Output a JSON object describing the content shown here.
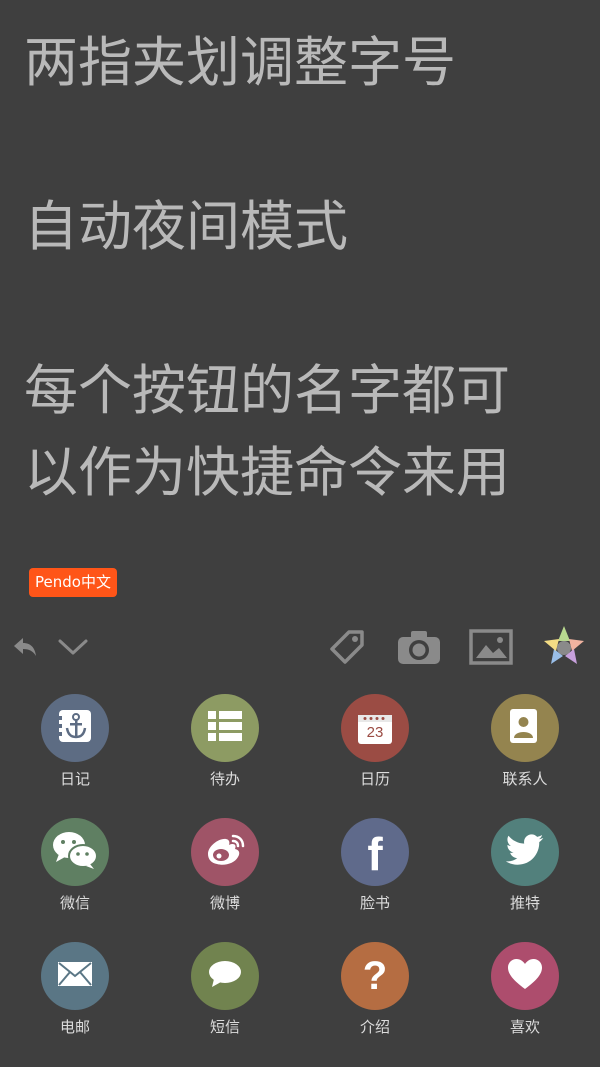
{
  "editor": {
    "line1": "两指夹划调整字号",
    "line2": "自动夜间模式",
    "line3": "每个按钮的名字都可",
    "line4": "以作为快捷命令来用"
  },
  "badge": {
    "label": "Pendo中文",
    "color": "#ff5518"
  },
  "toolbar": {
    "left_icons": [
      "undo-icon",
      "chevron-down-icon"
    ],
    "right_icons": [
      "tag-icon",
      "camera-icon",
      "image-icon",
      "star-palette-icon"
    ]
  },
  "actions": [
    {
      "label": "日记",
      "icon": "anchor-icon",
      "color": "#5d6c83"
    },
    {
      "label": "待办",
      "icon": "list-icon",
      "color": "#8d9b63"
    },
    {
      "label": "日历",
      "icon": "calendar-icon",
      "color": "#9b4c44",
      "icon_text": "23"
    },
    {
      "label": "联系人",
      "icon": "contact-card-icon",
      "color": "#94844f"
    },
    {
      "label": "微信",
      "icon": "wechat-icon",
      "color": "#5f7f62"
    },
    {
      "label": "微博",
      "icon": "weibo-icon",
      "color": "#9f5467"
    },
    {
      "label": "脸书",
      "icon": "facebook-icon",
      "color": "#5f6a8b",
      "icon_text": "f"
    },
    {
      "label": "推特",
      "icon": "twitter-icon",
      "color": "#52807c"
    },
    {
      "label": "电邮",
      "icon": "mail-icon",
      "color": "#5a7685"
    },
    {
      "label": "短信",
      "icon": "message-icon",
      "color": "#71834f"
    },
    {
      "label": "介绍",
      "icon": "question-icon",
      "color": "#b56d42",
      "icon_text": "?"
    },
    {
      "label": "喜欢",
      "icon": "heart-icon",
      "color": "#ad4d6d"
    }
  ]
}
